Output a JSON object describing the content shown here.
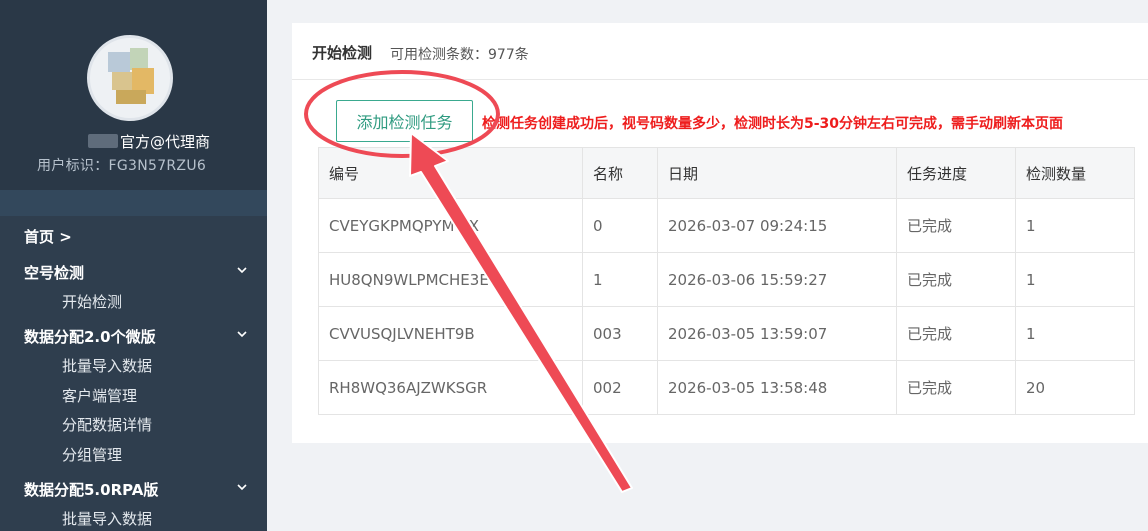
{
  "sidebar": {
    "username": "官方@代理商",
    "user_id": "用户标识：FG3N57RZU6",
    "home": "首页 >",
    "groups": [
      {
        "label": "空号检测",
        "items": [
          "开始检测"
        ]
      },
      {
        "label": "数据分配2.0个微版",
        "items": [
          "批量导入数据",
          "客户端管理",
          "分配数据详情",
          "分组管理"
        ]
      },
      {
        "label": "数据分配5.0RPA版",
        "items": [
          "批量导入数据"
        ]
      }
    ]
  },
  "main": {
    "title": "开始检测",
    "count_text": "可用检测条数：977条",
    "add_button": "添加检测任务",
    "hint": "检测任务创建成功后，视号码数量多少，检测时长为5-30分钟左右可完成，需手动刷新本页面",
    "table": {
      "headers": [
        "编号",
        "名称",
        "日期",
        "任务进度",
        "检测数量"
      ],
      "rows": [
        [
          "CVEYGKPMQPYM 9X",
          "0",
          "2026-03-07 09:24:15",
          "已完成",
          "1"
        ],
        [
          "HU8QN9WLPMCHE3E",
          "1",
          "2026-03-06 15:59:27",
          "已完成",
          "1"
        ],
        [
          "CVVUSQJLVNEHT9B",
          "003",
          "2026-03-05 13:59:07",
          "已完成",
          "1"
        ],
        [
          "RH8WQ36AJZWKSGR",
          "002",
          "2026-03-05 13:58:48",
          "已完成",
          "20"
        ]
      ]
    }
  },
  "colors": {
    "sidebar_bg": "#2f3e4e",
    "accent": "#2f9b80",
    "hint": "#ee1d1d",
    "annotation": "#ee4a55"
  }
}
